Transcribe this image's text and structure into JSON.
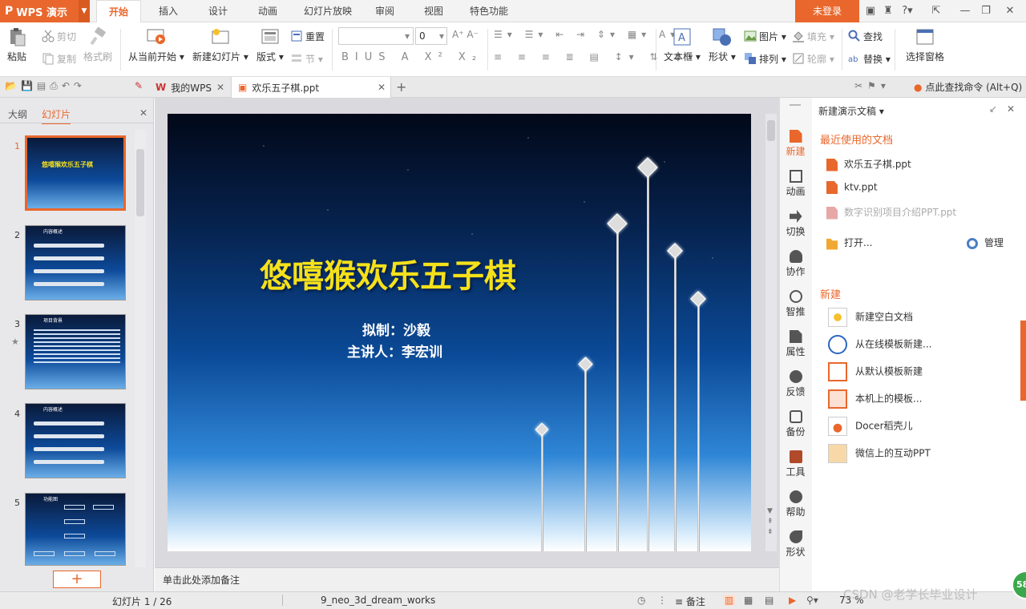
{
  "app": {
    "name": "WPS 演示",
    "logo": "P"
  },
  "menu": {
    "tabs": [
      "开始",
      "插入",
      "设计",
      "动画",
      "幻灯片放映",
      "审阅",
      "视图",
      "特色功能"
    ],
    "login": "未登录"
  },
  "ribbon": {
    "paste": "粘贴",
    "cut": "剪切",
    "copy": "复制",
    "format_painter": "格式刷",
    "from_current": "从当前开始",
    "new_slide": "新建幻灯片",
    "layout": "版式",
    "reset": "重置",
    "section": "节",
    "font_size": "0",
    "textbox": "文本框",
    "shapes": "形状",
    "picture": "图片",
    "fill": "填充",
    "arrange": "排列",
    "outline": "轮廓",
    "find": "查找",
    "replace": "替换",
    "select_pane": "选择窗格"
  },
  "doctabs": {
    "my_wps": "我的WPS",
    "file": "欢乐五子棋.ppt",
    "search_cmd": "点此查找命令 (Alt+Q)"
  },
  "leftpane": {
    "tab_outline": "大纲",
    "tab_slides": "幻灯片",
    "slides": [
      "1",
      "2",
      "3",
      "4",
      "5"
    ]
  },
  "thumbs": {
    "t1": "悠嘻猴欢乐五子棋",
    "t2": "内容概述",
    "t3": "项目背景",
    "t4": "内容概述",
    "t5": "功能图"
  },
  "slide": {
    "title": "悠嘻猴欢乐五子棋",
    "line1": "拟制：沙毅",
    "line2": "主讲人：李宏训"
  },
  "notes": "单击此处添加备注",
  "sidenav": [
    "新建",
    "动画",
    "切换",
    "协作",
    "智推",
    "属性",
    "反馈",
    "备份",
    "工具",
    "帮助",
    "形状"
  ],
  "taskpane": {
    "header": "新建演示文稿",
    "recent_title": "最近使用的文档",
    "recent": [
      "欢乐五子棋.ppt",
      "ktv.ppt",
      "数字识别项目介绍PPT.ppt"
    ],
    "open": "打开...",
    "manage": "管理",
    "new_title": "新建",
    "new_items": [
      "新建空白文档",
      "从在线模板新建...",
      "从默认模板新建",
      "本机上的模板...",
      "Docer稻壳儿",
      "微信上的互动PPT"
    ]
  },
  "status": {
    "slide_info": "幻灯片 1 / 26",
    "theme": "9_neo_3d_dream_works",
    "notes": "备注",
    "zoom": "73 %",
    "watermark": "CSDN @老学长毕业设计",
    "badge": "58"
  },
  "colors": {
    "accent": "#e9672c",
    "title_yellow": "#f5e11a"
  }
}
